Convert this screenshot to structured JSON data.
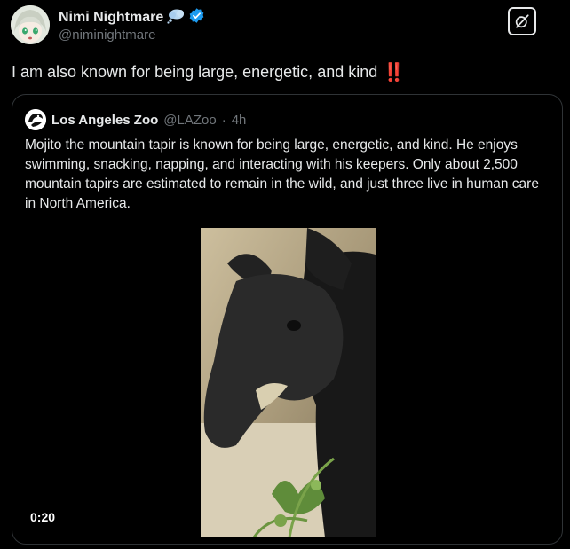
{
  "author": {
    "display_name": "Nimi Nightmare",
    "emoji_icon": "thought-bubble-icon",
    "verified_icon": "verified-badge-icon",
    "handle": "@niminightmare"
  },
  "tweet": {
    "text": "I am also known for being large, energetic, and kind",
    "emoji": "‼️"
  },
  "quote": {
    "display_name": "Los Angeles Zoo",
    "handle": "@LAZoo",
    "separator": "·",
    "time": "4h",
    "text": "Mojito the mountain tapir is known for being large, energetic, and kind. He enjoys swimming, snacking, napping, and interacting with his keepers. Only about 2,500 mountain tapirs are estimated to remain in the wild, and just three live in human care in North America.",
    "video_duration": "0:20"
  },
  "colors": {
    "background": "#000000",
    "text": "#e7e9ea",
    "muted": "#71767b",
    "border": "#2f3336",
    "verified": "#1d9bf0",
    "exclamation": "#e0245e"
  }
}
